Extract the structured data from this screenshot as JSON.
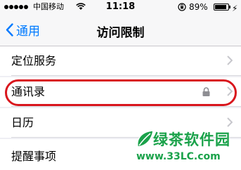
{
  "status_bar": {
    "carrier": "中国移动",
    "time": "11:18",
    "battery_percent": "89%",
    "battery_level": 0.89,
    "icons": [
      "signal-dots-icon",
      "wifi-icon",
      "rotation-lock-icon",
      "battery-icon",
      "charging-bolt-icon"
    ]
  },
  "nav": {
    "back_label": "通用",
    "title": "访问限制"
  },
  "rows": [
    {
      "label": "定位服务",
      "locked": false
    },
    {
      "label": "通讯录",
      "locked": true,
      "highlighted": true
    },
    {
      "label": "日历",
      "locked": false
    },
    {
      "label": "提醒事项",
      "locked": false
    }
  ],
  "watermark": {
    "title": "绿茶软件园",
    "url": "www.33LC.com"
  },
  "colors": {
    "accent": "#007aff",
    "highlight": "#d9161d",
    "watermark": "#1aa24a"
  }
}
